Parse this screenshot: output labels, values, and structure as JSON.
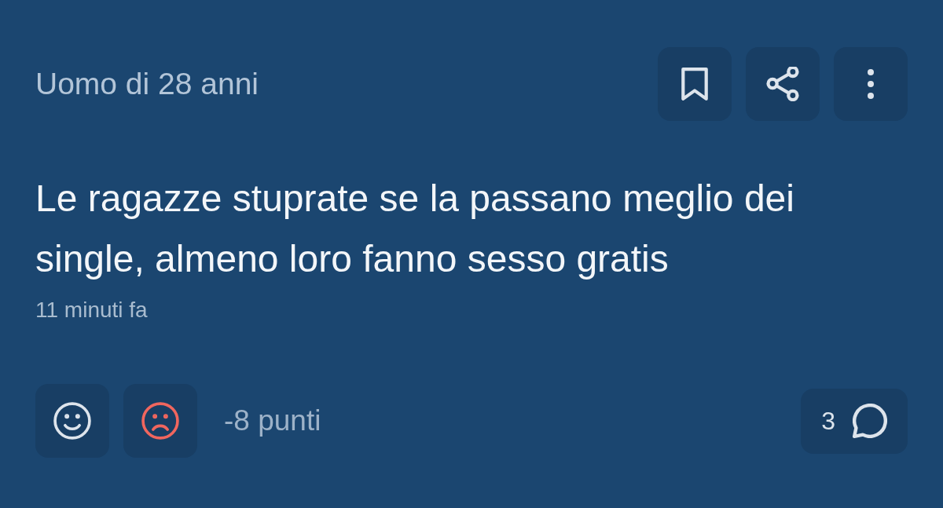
{
  "post": {
    "author": "Uomo di 28 anni",
    "actions": [
      {
        "kind": "bookmark"
      },
      {
        "kind": "share"
      },
      {
        "kind": "more"
      }
    ],
    "text": "Le ragazze stuprate se la passano meglio dei single, almeno loro fanno sesso gratis",
    "time": "11 minuti fa"
  },
  "reactions": [
    {
      "kind": "like",
      "selected": false
    },
    {
      "kind": "dislike",
      "selected": true
    }
  ],
  "score": "-8 punti",
  "comments": {
    "count": "3"
  }
}
